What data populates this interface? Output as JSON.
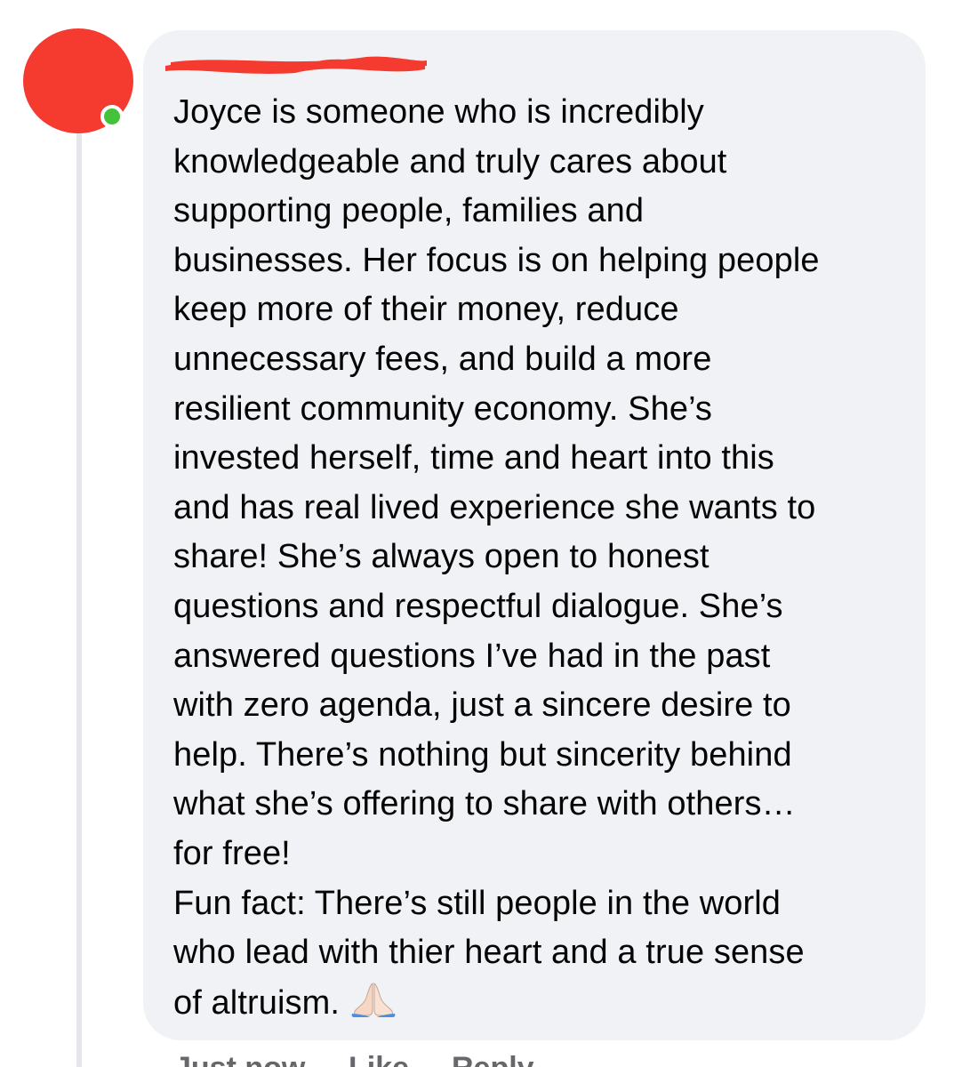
{
  "comment": {
    "lines": [
      "Joyce is someone who is incredibly",
      "knowledgeable and truly cares about",
      "supporting people, families and",
      "businesses. Her focus is on helping people",
      "keep more of their money, reduce",
      "unnecessary fees, and build a more",
      "resilient community economy. She’s",
      "invested herself, time and heart into this",
      "and has real lived experience she wants to",
      "share! She’s always open to honest",
      "questions and respectful dialogue. She’s",
      "answered questions I’ve had in the past",
      "with zero agenda, just a sincere desire to",
      "help. There’s nothing but sincerity behind",
      "what she’s offering to share with others…",
      "for free!",
      "Fun fact: There’s still people in the world",
      "who lead with thier heart and a true sense",
      "of altruism."
    ],
    "emoji": "folded-hands-icon"
  },
  "actions": {
    "time": "Just now",
    "like": "Like",
    "reply": "Reply"
  },
  "colors": {
    "avatar": "#f53a30",
    "online": "#44c23a",
    "bubble": "#f0f2f5",
    "redaction": "#f53a30"
  }
}
